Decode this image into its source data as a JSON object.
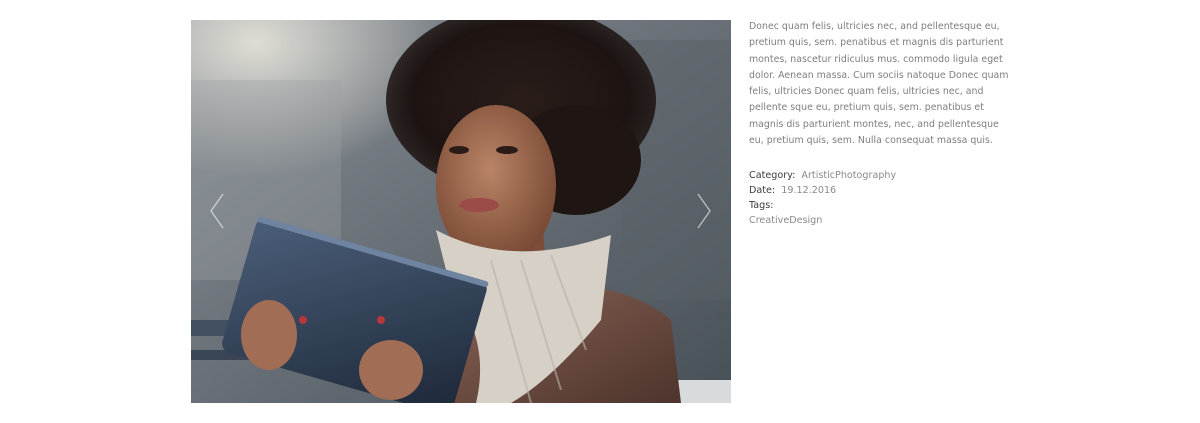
{
  "project": {
    "description": "Donec quam felis, ultricies nec, and pellentesque eu, pretium quis, sem. penatibus et magnis dis parturient montes, nascetur ridiculus mus. commodo ligula eget dolor. Aenean massa. Cum sociis natoque Donec quam felis, ultricies Donec quam felis, ultricies nec, and pellente sque eu, pretium quis, sem. penatibus et magnis dis parturient montes, nec, and pellentesque eu, pretium quis, sem. Nulla consequat massa quis.",
    "category_label": "Category:",
    "category_value": "ArtisticPhotography",
    "date_label": "Date:",
    "date_value": "19.12.2016",
    "tags_label": "Tags:",
    "tags_value": "CreativeDesign"
  },
  "slider": {
    "prev_icon": "chevron-left-icon",
    "next_icon": "chevron-right-icon"
  },
  "colors": {
    "label": "#3c3c3c",
    "text": "#7e7e7e",
    "photo_bg": "#5d6670"
  }
}
